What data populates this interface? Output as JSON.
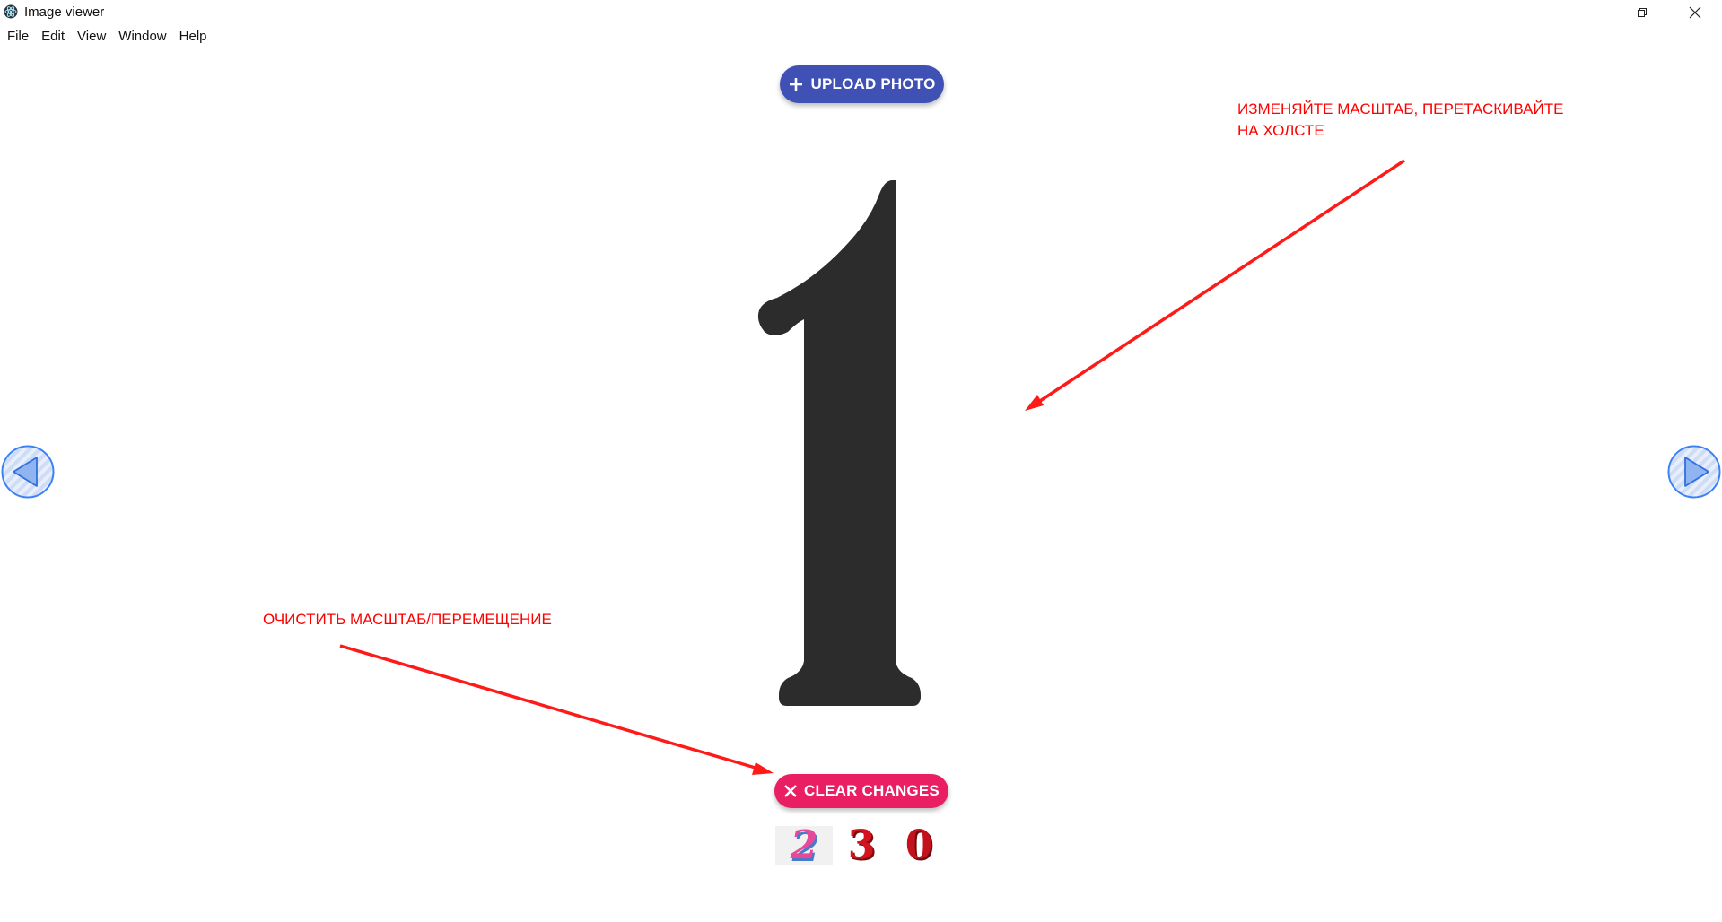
{
  "window": {
    "title": "Image viewer",
    "controls": [
      "minimize",
      "maximize",
      "close"
    ]
  },
  "menu": [
    "File",
    "Edit",
    "View",
    "Window",
    "Help"
  ],
  "toolbar": {
    "upload_label": "UPLOAD PHOTO",
    "upload_icon": "plus-icon",
    "upload_color": "#3f51b5",
    "clear_label": "CLEAR CHANGES",
    "clear_icon": "close-icon",
    "clear_color": "#e91e63"
  },
  "viewer": {
    "current_image": "1",
    "prev_icon": "arrow-left-icon",
    "next_icon": "arrow-right-icon"
  },
  "annotations": {
    "zoom_hint": "ИЗМЕНЯЙТЕ МАСШТАБ, ПЕРЕТАСКИВАЙТЕ\nНА ХОЛСТЕ",
    "reset_hint": "ОЧИСТИТЬ МАСШТАБ/ПЕРЕМЕЩЕНИЕ",
    "color": "#ff0000"
  },
  "thumbnails": [
    "2",
    "3",
    "0"
  ]
}
